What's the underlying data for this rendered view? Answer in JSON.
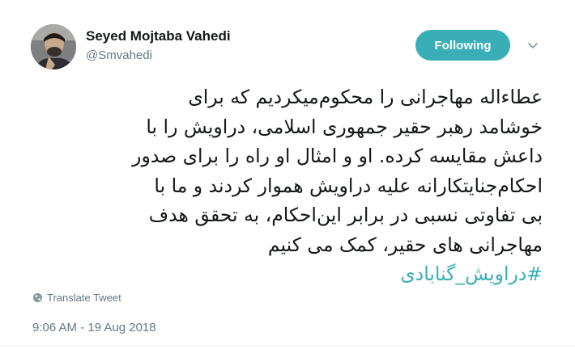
{
  "user": {
    "display_name": "Seyed Mojtaba Vahedi",
    "handle": "@Smvahedi"
  },
  "follow_button": {
    "label": "Following"
  },
  "icons": {
    "caret": "chevron-down-icon",
    "translate": "globe-icon"
  },
  "tweet": {
    "lines": [
      "عطاءاله مهاجرانی را محکوم‌میکردیم که برای",
      "خوشامد رهبر حقیر جمهوری اسلامی، دراویش را با",
      "داعش مقایسه کرده. او و امثال او راه را برای صدور",
      "احکام‌جنایتکارانه علیه دراویش هموار کردند و ما با",
      "بی تفاوتی نسبی در برابر این‌احکام، به تحقق هدف",
      "مهاجرانی های حقیر، کمک می کنیم"
    ],
    "hashtag": "#دراویش_گنابادی"
  },
  "translate_label": "Translate Tweet",
  "timestamp": "9:06 AM - 19 Aug 2018",
  "colors": {
    "accent": "#3aaeb6",
    "secondary_text": "#657786",
    "primary_text": "#14171a"
  }
}
